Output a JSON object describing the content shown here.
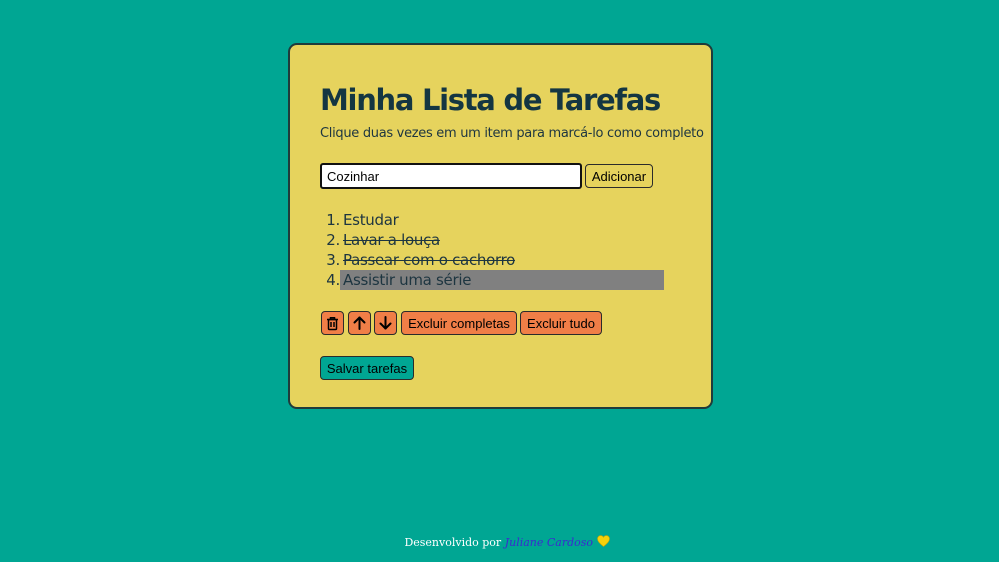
{
  "app": {
    "title": "Minha Lista de Tarefas",
    "subtitle": "Clique duas vezes em um item para marcá-lo como completo"
  },
  "form": {
    "input_value": "Cozinhar",
    "add_label": "Adicionar"
  },
  "tasks": [
    {
      "number": "1.",
      "text": "Estudar",
      "completed": false,
      "selected": false
    },
    {
      "number": "2.",
      "text": "Lavar a louça",
      "completed": true,
      "selected": false
    },
    {
      "number": "3.",
      "text": "Passear com o cachorro",
      "completed": true,
      "selected": false
    },
    {
      "number": "4.",
      "text": "Assistir uma série",
      "completed": false,
      "selected": true
    }
  ],
  "actions": {
    "remove_icon": "trash-icon",
    "up_icon": "arrow-up-icon",
    "down_icon": "arrow-down-icon",
    "clear_completed_label": "Excluir completas",
    "clear_all_label": "Excluir tudo",
    "save_label": "Salvar tarefas"
  },
  "footer": {
    "prefix": "Desenvolvido por",
    "author": "Juliane Cardoso",
    "heart_icon": "yellow-heart-icon"
  },
  "colors": {
    "background": "#00a693",
    "card": "#e6d35d",
    "title": "#143642",
    "action_button": "#f07e47",
    "save_button": "#00a693",
    "selected_item": "#808080",
    "author_link": "#3a2bd0",
    "heart": "#f5d10a"
  }
}
